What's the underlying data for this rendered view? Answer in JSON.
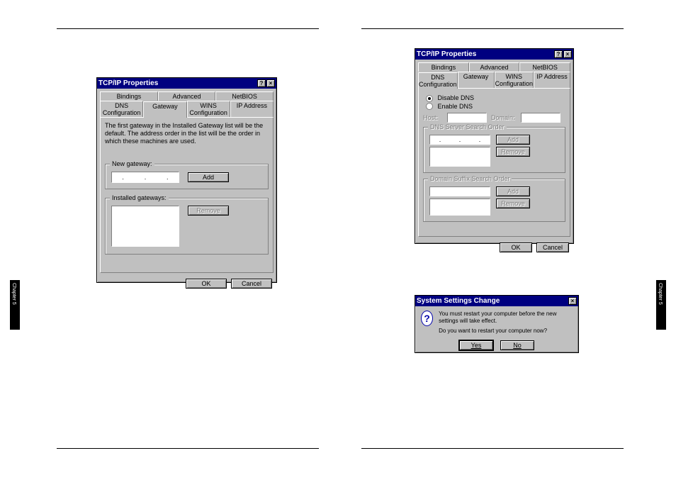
{
  "side_tab_label": "Chapter 5",
  "dialog1": {
    "title": "TCP/IP Properties",
    "tabs_back": [
      "Bindings",
      "Advanced",
      "NetBIOS"
    ],
    "tabs_front": [
      "DNS Configuration",
      "Gateway",
      "WINS Configuration",
      "IP Address"
    ],
    "active_tab": "Gateway",
    "intro_text": "The first gateway in the Installed Gateway list will be the default. The address order in the list will be the order in which these machines are used.",
    "new_gateway_label": "New gateway:",
    "add_label": "Add",
    "installed_label": "Installed gateways:",
    "remove_label": "Remove",
    "ok_label": "OK",
    "cancel_label": "Cancel"
  },
  "dialog2": {
    "title": "TCP/IP Properties",
    "tabs_back": [
      "Bindings",
      "Advanced",
      "NetBIOS"
    ],
    "tabs_front": [
      "DNS Configuration",
      "Gateway",
      "WINS Configuration",
      "IP Address"
    ],
    "active_tab": "DNS Configuration",
    "disable_label": "Disable DNS",
    "enable_label": "Enable DNS",
    "host_label": "Host:",
    "domain_label": "Domain:",
    "dns_search_label": "DNS Server Search Order",
    "add_label": "Add",
    "remove_label": "Remove",
    "domain_suffix_label": "Domain Suffix Search Order",
    "ok_label": "OK",
    "cancel_label": "Cancel"
  },
  "dialog3": {
    "title": "System Settings Change",
    "line1": "You must restart your computer before the new settings will take effect.",
    "line2": "Do you want to restart your computer now?",
    "yes_label": "Yes",
    "no_label": "No"
  }
}
